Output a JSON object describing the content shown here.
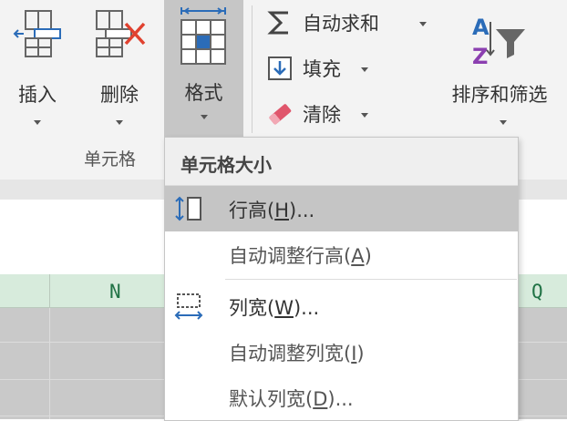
{
  "ribbon": {
    "cells_group": {
      "insert_label": "插入",
      "delete_label": "删除",
      "format_label": "格式",
      "group_label": "单元格"
    },
    "editing_group": {
      "autosum_label": "自动求和",
      "fill_label": "填充",
      "clear_label": "清除",
      "sort_filter_label": "排序和筛选"
    }
  },
  "columns": {
    "n_label": "N",
    "q_label": "Q"
  },
  "format_menu": {
    "section_title": "单元格大小",
    "items": [
      {
        "label": "行高(",
        "key": "H",
        "suffix": ")..."
      },
      {
        "label": "自动调整行高(",
        "key": "A",
        "suffix": ")"
      },
      {
        "label": "列宽(",
        "key": "W",
        "suffix": ")..."
      },
      {
        "label": "自动调整列宽(",
        "key": "I",
        "suffix": ")"
      },
      {
        "label": "默认列宽(",
        "key": "D",
        "suffix": ")..."
      }
    ]
  },
  "colors": {
    "accent_blue": "#2b6cb8",
    "delete_red": "#e0412f",
    "sort_purple": "#8b3fb0",
    "clear_pink": "#e0566c",
    "column_header_green": "#d7ebdc",
    "column_text_green": "#217346"
  }
}
